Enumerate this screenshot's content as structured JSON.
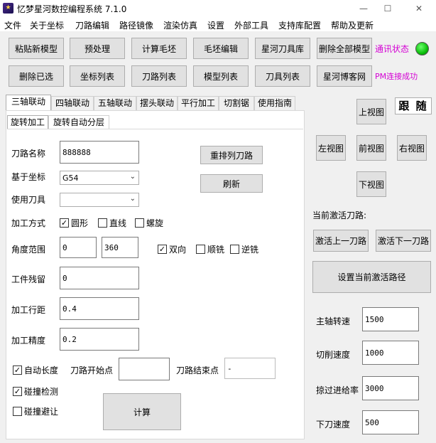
{
  "window": {
    "title": "忆梦星河数控编程系统  7.1.0",
    "minimize": "—",
    "maximize": "☐",
    "close": "✕"
  },
  "menu": [
    "文件",
    "关于坐标",
    "刀路编辑",
    "路径镜像",
    "渲染仿真",
    "设置",
    "外部工具",
    "支持库配置",
    "帮助及更新"
  ],
  "toolbar": {
    "row1": [
      "粘贴新模型",
      "预处理",
      "计算毛坯",
      "毛坯编辑",
      "星河刀具库",
      "删除全部模型"
    ],
    "row2": [
      "删除已选",
      "坐标列表",
      "刀路列表",
      "模型列表",
      "刀具列表",
      "星河博客网"
    ]
  },
  "status": {
    "comm": "通讯状态",
    "pm": "PM连接成功",
    "led_color": "#19c519"
  },
  "tabs": [
    "三轴联动",
    "四轴联动",
    "五轴联动",
    "摆头联动",
    "平行加工",
    "切割锯",
    "使用指南"
  ],
  "subtabs": [
    "旋转加工",
    "旋转自动分层"
  ],
  "form": {
    "path_name_label": "刀路名称",
    "path_name": "888888",
    "coord_label": "基于坐标",
    "coord_value": "G54",
    "tool_label": "使用刀具",
    "tool_value": "",
    "method_label": "加工方式",
    "method_circle": "圆形",
    "method_line": "直线",
    "method_spiral": "螺旋",
    "angle_label": "角度范围",
    "angle_from": "0",
    "angle_to": "360",
    "bidir": "双向",
    "climb": "顺铣",
    "conventional": "逆铣",
    "residual_label": "工件残留",
    "residual": "0",
    "step_label": "加工行距",
    "step": "0.4",
    "precision_label": "加工精度",
    "precision": "0.2",
    "auto_length": "自动长度",
    "start_label": "刀路开始点",
    "start_value": "",
    "end_label": "刀路结束点",
    "end_value": "-",
    "collision_detect": "碰撞检测",
    "collision_avoid": "碰撞避让",
    "reorder_btn": "重排列刀路",
    "refresh_btn": "刷新",
    "calc_btn": "计算"
  },
  "checks": {
    "circle": true,
    "line": false,
    "spiral": false,
    "bidir": true,
    "climb": false,
    "conventional": false,
    "auto_length": true,
    "collision_detect": true,
    "collision_avoid": false
  },
  "views": {
    "top": "上视图",
    "left": "左视图",
    "front": "前视图",
    "right": "右视图",
    "bottom": "下视图",
    "logo": "跟 随"
  },
  "active_path": {
    "label": "当前激活刀路:",
    "prev": "激活上一刀路",
    "next": "激活下一刀路",
    "set": "设置当前激活路径"
  },
  "params": {
    "spindle_label": "主轴转速",
    "spindle": "1500",
    "cut_label": "切削速度",
    "cut": "1000",
    "feed_label": "掠过进给率",
    "feed": "3000",
    "plunge_label": "下刀速度",
    "plunge": "500"
  }
}
